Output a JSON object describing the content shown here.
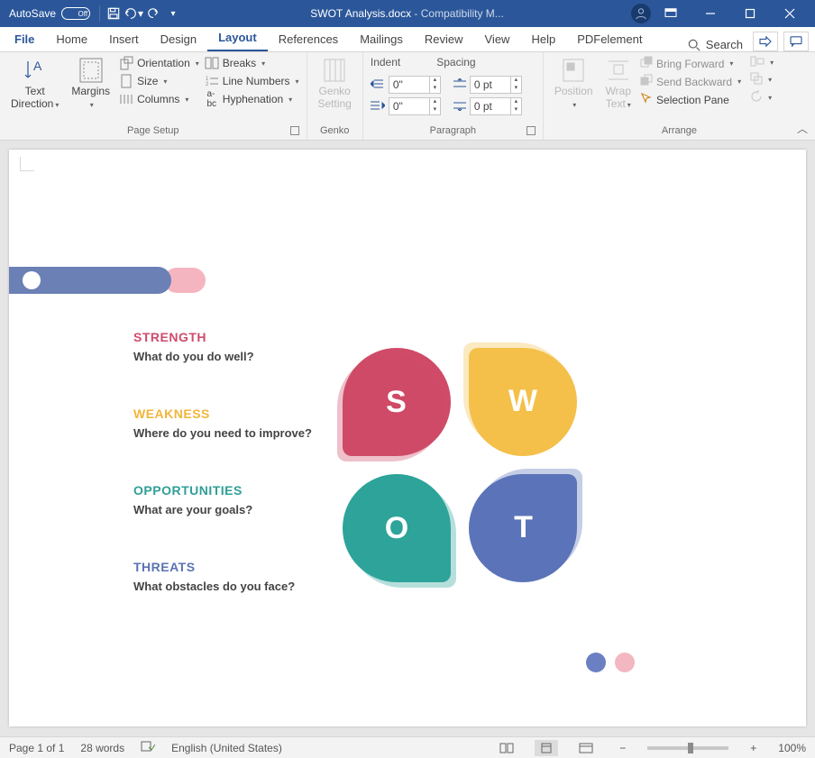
{
  "titlebar": {
    "autosave_label": "AutoSave",
    "autosave_state": "Off",
    "filename": "SWOT Analysis.docx",
    "mode_suffix": "  -  Compatibility M..."
  },
  "tabs": {
    "file": "File",
    "home": "Home",
    "insert": "Insert",
    "design": "Design",
    "layout": "Layout",
    "references": "References",
    "mailings": "Mailings",
    "review": "Review",
    "view": "View",
    "help": "Help",
    "pdfelement": "PDFelement",
    "search": "Search"
  },
  "ribbon": {
    "page_setup": {
      "name": "Page Setup",
      "text_direction": "Text\nDirection",
      "margins": "Margins",
      "orientation": "Orientation",
      "size": "Size",
      "columns": "Columns",
      "breaks": "Breaks",
      "line_numbers": "Line Numbers",
      "hyphenation": "Hyphenation"
    },
    "genko": {
      "name": "Genko",
      "btn": "Genko\nSetting"
    },
    "paragraph": {
      "name": "Paragraph",
      "indent": "Indent",
      "spacing": "Spacing",
      "indent_left": "0\"",
      "indent_right": "0\"",
      "space_before": "0 pt",
      "space_after": "0 pt"
    },
    "arrange": {
      "name": "Arrange",
      "position": "Position",
      "wrap_text": "Wrap\nText",
      "bring_forward": "Bring Forward",
      "send_backward": "Send Backward",
      "selection_pane": "Selection Pane"
    }
  },
  "document": {
    "strength_h": "STRENGTH",
    "strength_q": "What do you do well?",
    "weakness_h": "WEAKNESS",
    "weakness_q": "Where do you need to improve?",
    "opportunities_h": "OPPORTUNITIES",
    "opportunities_q": "What are your goals?",
    "threats_h": "THREATS",
    "threats_q": "What obstacles do you face?",
    "letter_s": "S",
    "letter_w": "W",
    "letter_o": "O",
    "letter_t": "T"
  },
  "statusbar": {
    "page": "Page 1 of 1",
    "words": "28 words",
    "language": "English (United States)",
    "zoom": "100%"
  }
}
